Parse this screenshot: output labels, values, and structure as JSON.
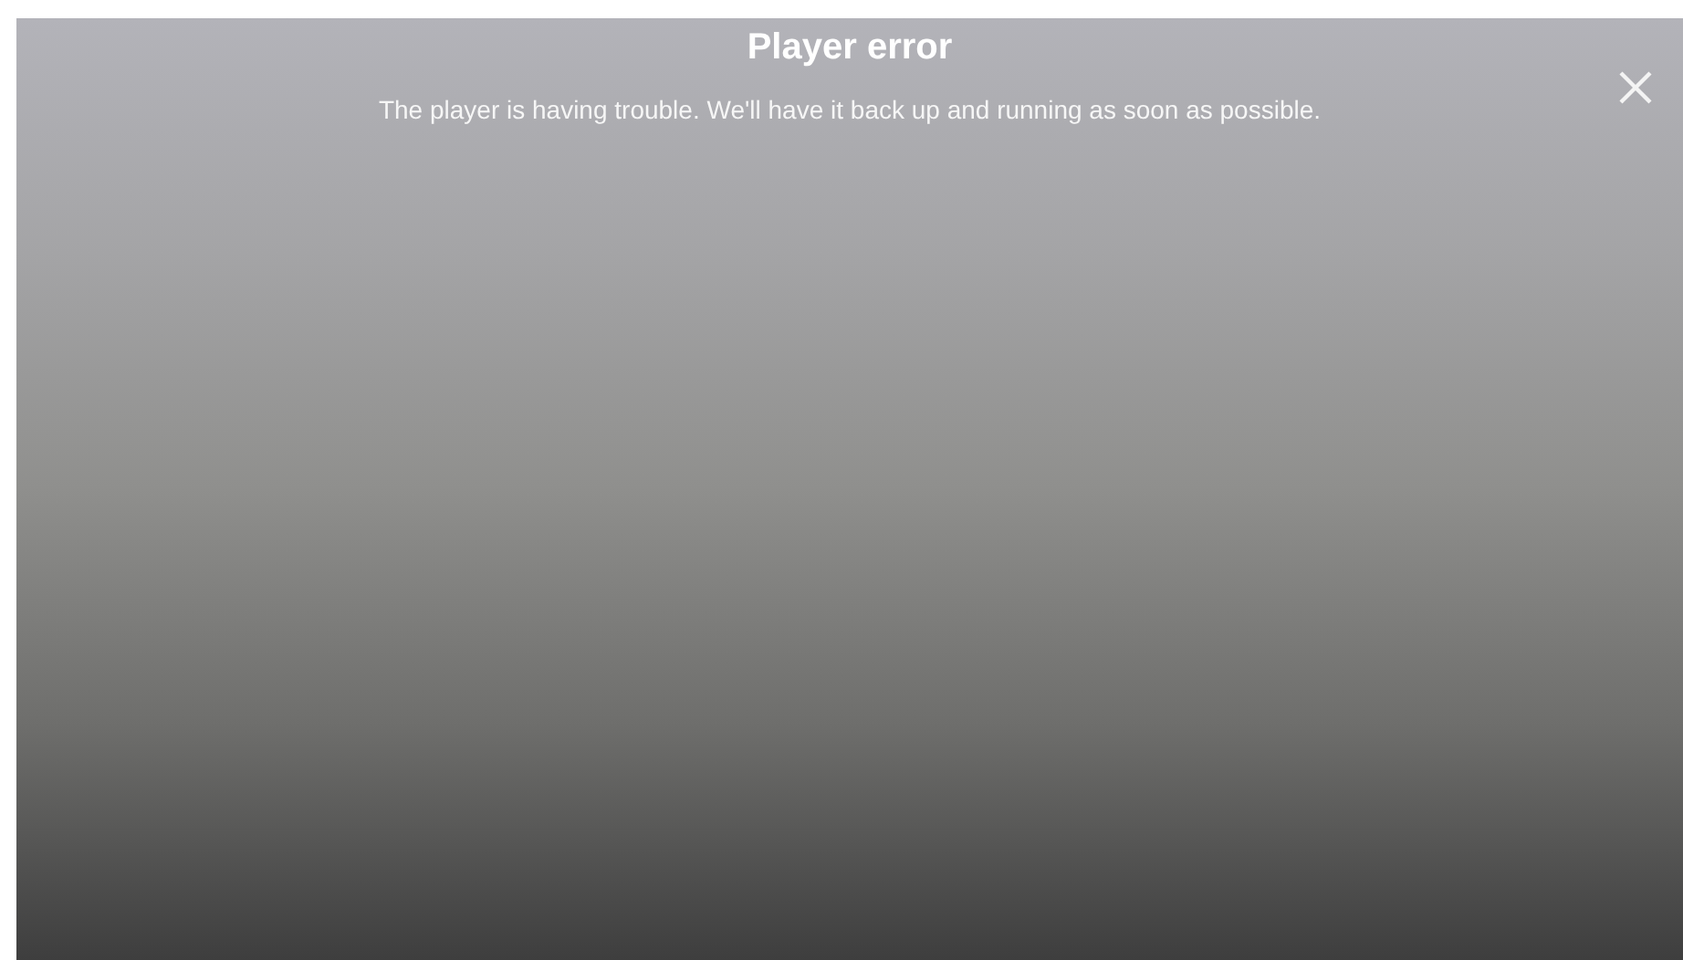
{
  "dialog": {
    "title": "Player error",
    "message": "The player is having trouble. We'll have it back up and running as soon as possible."
  }
}
